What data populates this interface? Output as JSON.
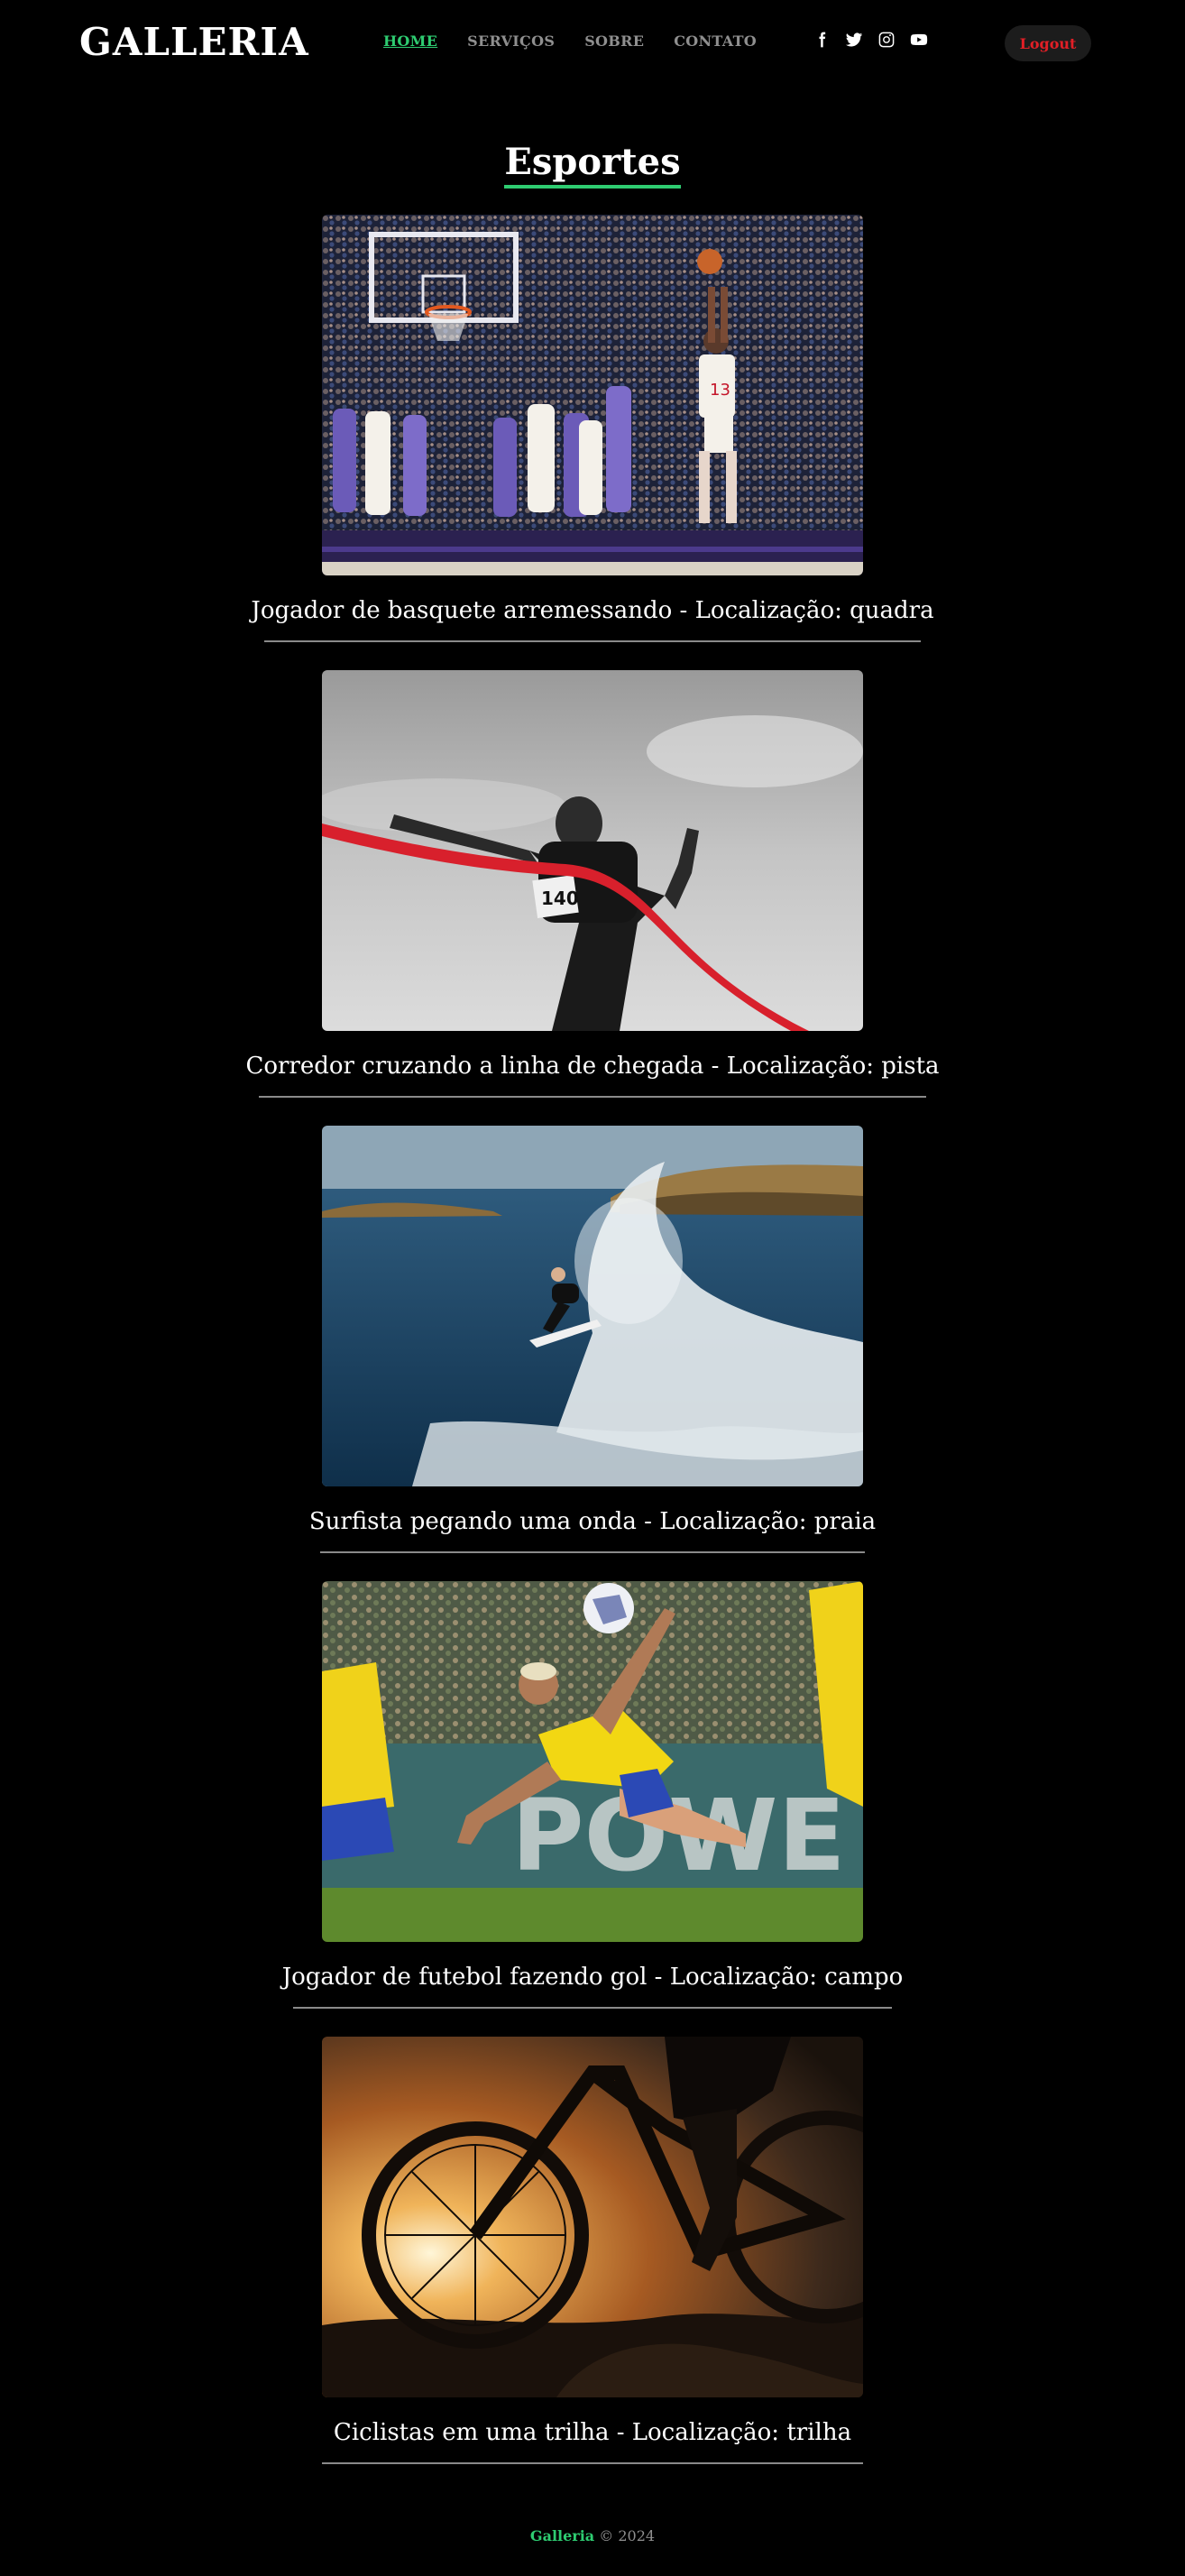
{
  "header": {
    "logo": "GALLERIA",
    "nav": [
      {
        "label": "HOME",
        "active": true
      },
      {
        "label": "SERVIÇOS",
        "active": false
      },
      {
        "label": "SOBRE",
        "active": false
      },
      {
        "label": "CONTATO",
        "active": false
      }
    ],
    "socials": [
      "facebook-icon",
      "twitter-icon",
      "instagram-icon",
      "youtube-icon"
    ],
    "logout_label": "Logout"
  },
  "main": {
    "section_title": "Esportes",
    "items": [
      {
        "caption": "Jogador de basquete arremessando - Localização: quadra",
        "image": "basketball-player-shooting"
      },
      {
        "caption": "Corredor cruzando a linha de chegada - Localização: pista",
        "image": "runner-finish-line"
      },
      {
        "caption": "Surfista pegando uma onda - Localização: praia",
        "image": "surfer-on-wave"
      },
      {
        "caption": "Jogador de futebol fazendo gol - Localização: campo",
        "image": "football-bicycle-kick"
      },
      {
        "caption": "Ciclistas em uma trilha - Localização: trilha",
        "image": "mountain-bike-sunset"
      }
    ]
  },
  "footer": {
    "brand": "Galleria",
    "text": "© 2024"
  },
  "colors": {
    "background": "#000000",
    "accent": "#2ecc71",
    "logout_text": "#e21f26",
    "muted": "#8f8f8f"
  }
}
